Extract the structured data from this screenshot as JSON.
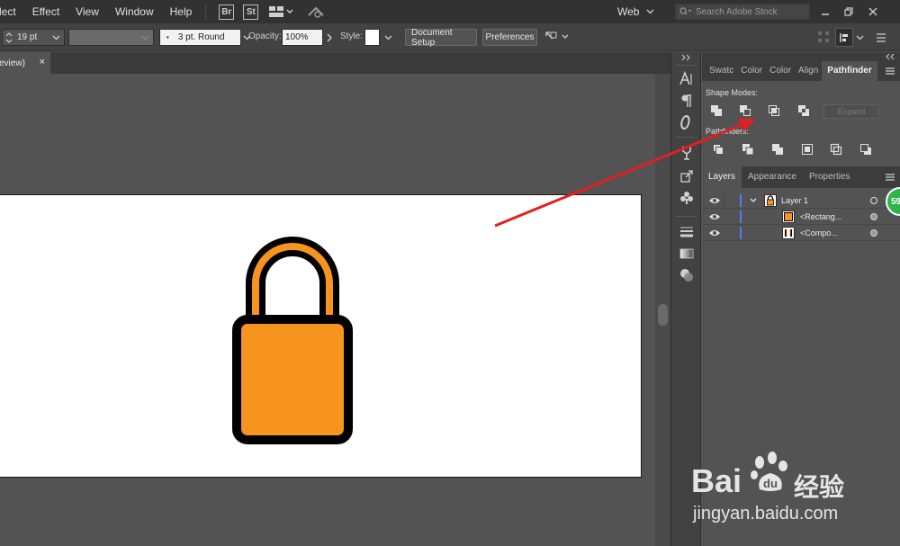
{
  "menubar": {
    "items": [
      "lect",
      "Effect",
      "View",
      "Window",
      "Help"
    ],
    "badges": [
      "Br",
      "St"
    ],
    "workspace": "Web",
    "search_placeholder": "Search Adobe Stock"
  },
  "controlbar": {
    "stroke_size": "19 pt",
    "brush": "3 pt. Round",
    "opacity_label": "Opacity:",
    "opacity_value": "100%",
    "style_label": "Style:",
    "document_setup": "Document Setup",
    "preferences": "Preferences"
  },
  "document_tab": {
    "label": "eview)",
    "close": "×"
  },
  "pathfinder_panel": {
    "tabs": [
      "Swatc",
      "Color",
      "Color",
      "Align",
      "Pathfinder"
    ],
    "active_tab": "Pathfinder",
    "shape_modes_label": "Shape Modes:",
    "pathfinders_label": "Pathfinders:",
    "expand_label": "Expand"
  },
  "layers_panel": {
    "tabs": [
      "Layers",
      "Appearance",
      "Properties"
    ],
    "active_tab": "Layers",
    "rows": [
      {
        "name": "Layer 1"
      },
      {
        "name": "<Rectang..."
      },
      {
        "name": "<Compo..."
      }
    ]
  },
  "badge": "59",
  "watermark": {
    "brand": "Bai",
    "brand_suffix": "经验",
    "url": "jingyan.baidu.com"
  },
  "colors": {
    "lock_orange": "#F7941E",
    "lock_outline": "#000000",
    "arrow": "#E02020",
    "layer_color": "#4F7CFF"
  }
}
